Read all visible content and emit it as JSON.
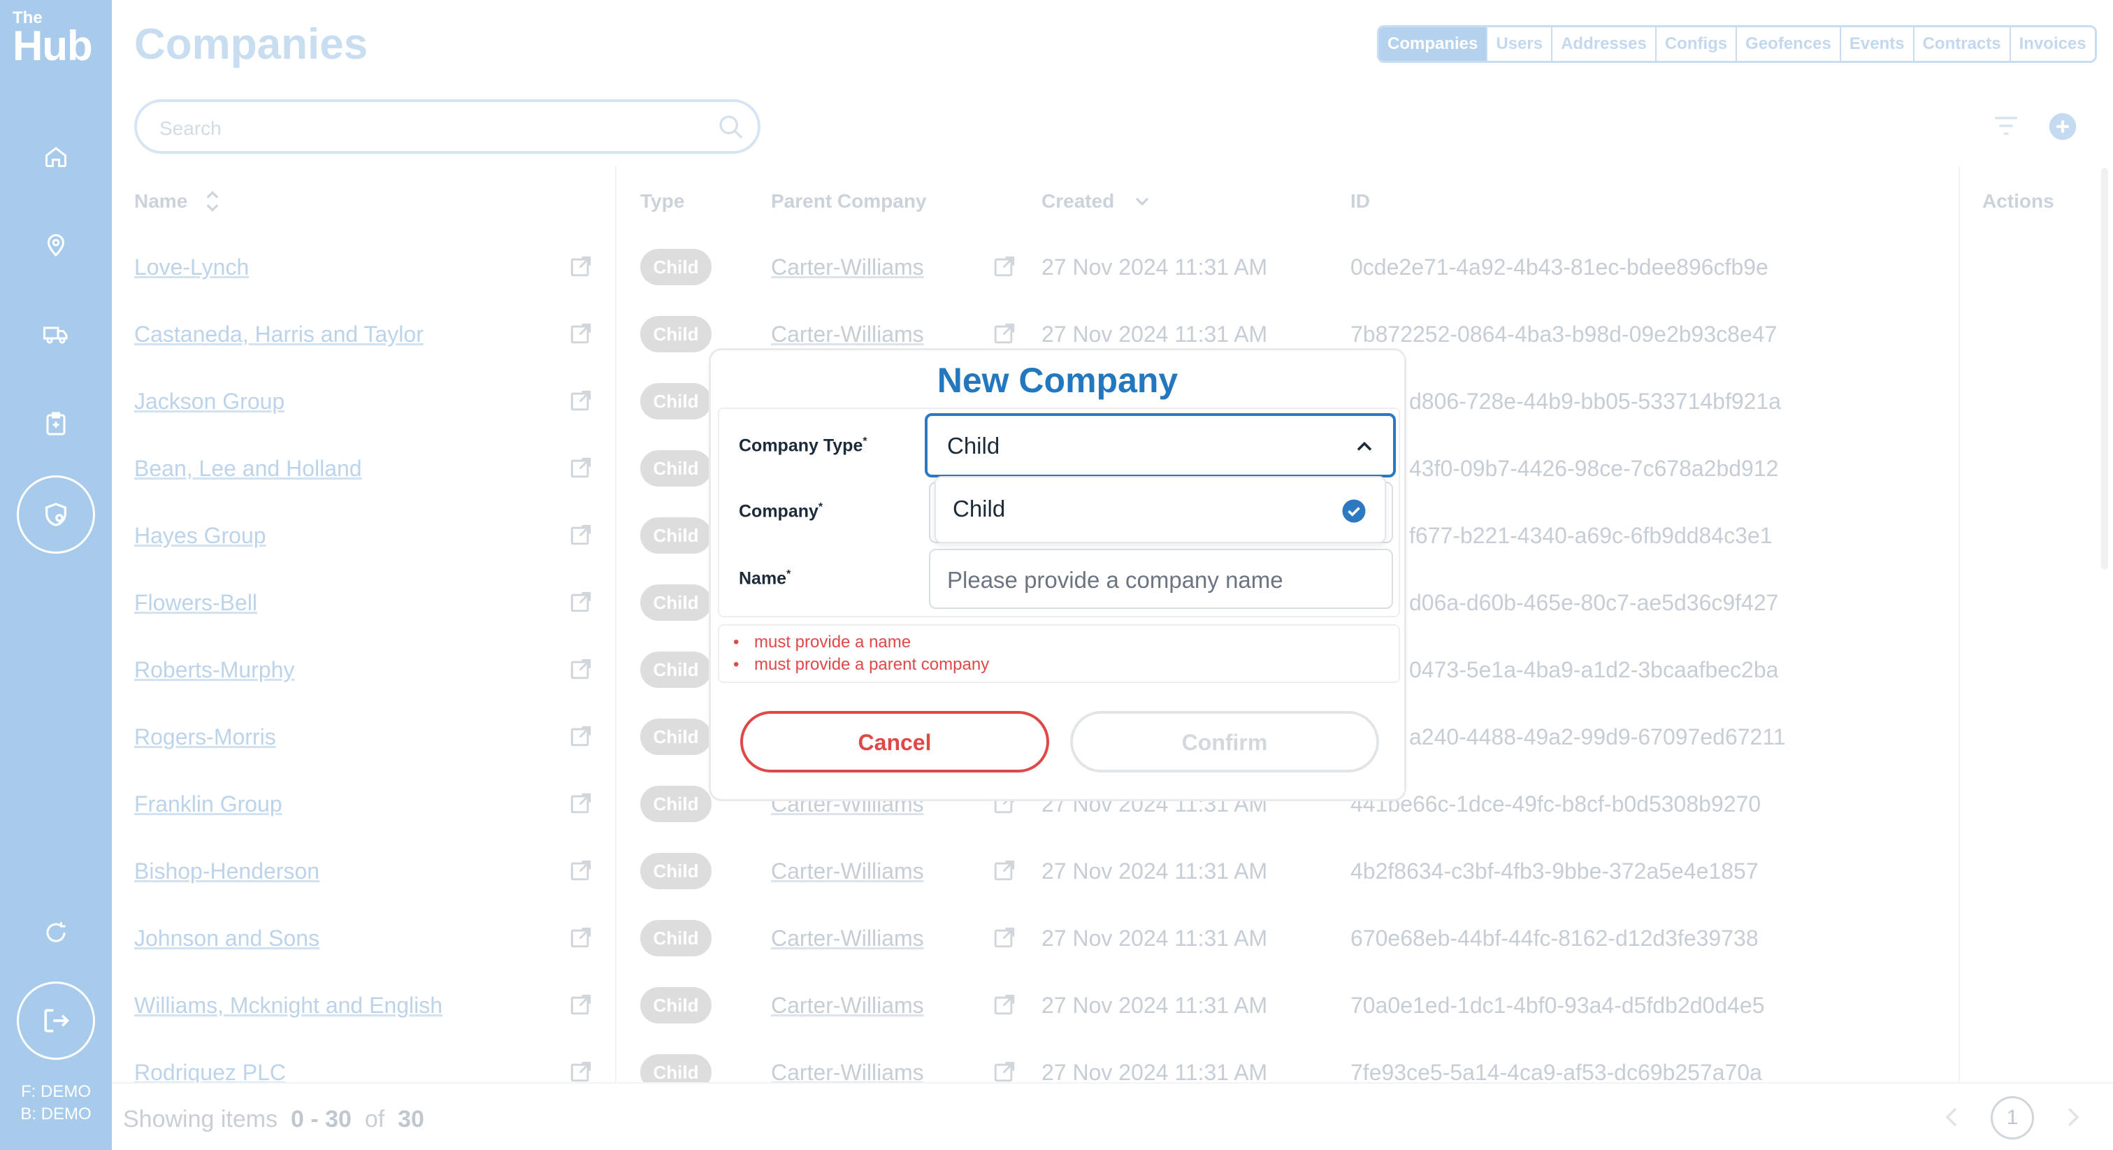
{
  "sidebar": {
    "logo_top": "The",
    "logo_bottom": "Hub",
    "env_f": "F: DEMO",
    "env_b": "B: DEMO"
  },
  "header": {
    "title": "Companies",
    "tabs": [
      "Companies",
      "Users",
      "Addresses",
      "Configs",
      "Geofences",
      "Events",
      "Contracts",
      "Invoices"
    ],
    "active_tab": "Companies"
  },
  "search": {
    "placeholder": "Search"
  },
  "table": {
    "columns": [
      "Name",
      "Type",
      "Parent Company",
      "Created",
      "ID",
      "Actions"
    ],
    "rows": [
      {
        "name": "Love-Lynch",
        "type": "Child",
        "parent": "Carter-Williams",
        "created": "27 Nov 2024 11:31 AM",
        "id": "0cde2e71-4a92-4b43-81ec-bdee896cfb9e"
      },
      {
        "name": "Castaneda, Harris and Taylor",
        "type": "Child",
        "parent": "Carter-Williams",
        "created": "27 Nov 2024 11:31 AM",
        "id": "7b872252-0864-4ba3-b98d-09e2b93c8e47"
      },
      {
        "name": "Jackson Group",
        "type": "Child",
        "parent": "",
        "created": "",
        "id": "d806-728e-44b9-bb05-533714bf921a"
      },
      {
        "name": "Bean, Lee and Holland",
        "type": "Child",
        "parent": "",
        "created": "",
        "id": "43f0-09b7-4426-98ce-7c678a2bd912"
      },
      {
        "name": "Hayes Group",
        "type": "Child",
        "parent": "",
        "created": "",
        "id": "f677-b221-4340-a69c-6fb9dd84c3e1"
      },
      {
        "name": "Flowers-Bell",
        "type": "Child",
        "parent": "",
        "created": "",
        "id": "d06a-d60b-465e-80c7-ae5d36c9f427"
      },
      {
        "name": "Roberts-Murphy",
        "type": "Child",
        "parent": "",
        "created": "",
        "id": "0473-5e1a-4ba9-a1d2-3bcaafbec2ba"
      },
      {
        "name": "Rogers-Morris",
        "type": "Child",
        "parent": "",
        "created": "",
        "id": "a240-4488-49a2-99d9-67097ed67211"
      },
      {
        "name": "Franklin Group",
        "type": "Child",
        "parent": "Carter-Williams",
        "created": "27 Nov 2024 11:31 AM",
        "id": "441be66c-1dce-49fc-b8cf-b0d5308b9270"
      },
      {
        "name": "Bishop-Henderson",
        "type": "Child",
        "parent": "Carter-Williams",
        "created": "27 Nov 2024 11:31 AM",
        "id": "4b2f8634-c3bf-4fb3-9bbe-372a5e4e1857"
      },
      {
        "name": "Johnson and Sons",
        "type": "Child",
        "parent": "Carter-Williams",
        "created": "27 Nov 2024 11:31 AM",
        "id": "670e68eb-44bf-44fc-8162-d12d3fe39738"
      },
      {
        "name": "Williams, Mcknight and English",
        "type": "Child",
        "parent": "Carter-Williams",
        "created": "27 Nov 2024 11:31 AM",
        "id": "70a0e1ed-1dc1-4bf0-93a4-d5fdb2d0d4e5"
      },
      {
        "name": "Rodriquez PLC",
        "type": "Child",
        "parent": "Carter-Williams",
        "created": "27 Nov 2024 11:31 AM",
        "id": "7fe93ce5-5a14-4ca9-af53-dc69b257a70a"
      }
    ]
  },
  "footer": {
    "showing_label": "Showing items",
    "range": "0 - 30",
    "of_label": "of",
    "total": "30",
    "page": "1"
  },
  "modal": {
    "title": "New Company",
    "company_type_label": "Company Type",
    "company_label": "Company",
    "name_label": "Name",
    "required_mark": "*",
    "company_type_value": "Child",
    "dropdown_option": "Child",
    "name_placeholder": "Please provide a company name",
    "errors": [
      "must provide a name",
      "must provide a parent company"
    ],
    "cancel_label": "Cancel",
    "confirm_label": "Confirm"
  },
  "colors": {
    "sidebar": "#a8cbec",
    "accent": "#2c79c1",
    "title_blue": "#2377be",
    "error": "#e04848"
  }
}
